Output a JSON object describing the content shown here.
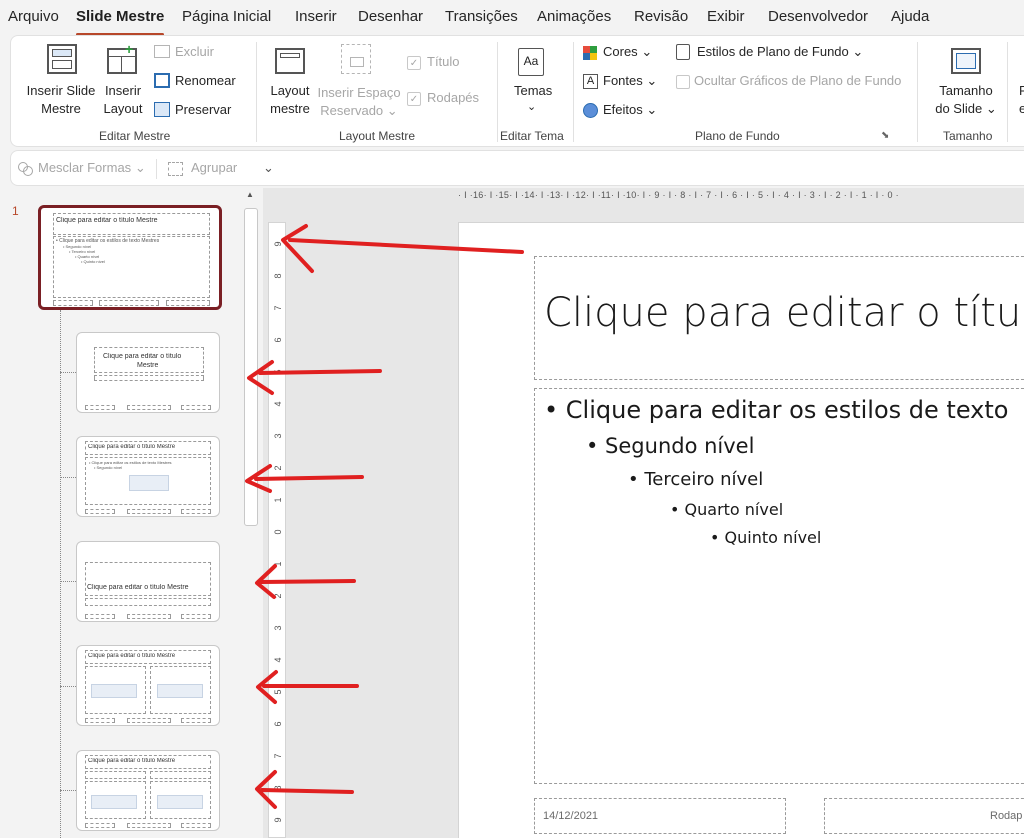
{
  "menu": {
    "tabs": [
      {
        "label": "Arquivo"
      },
      {
        "label": "Slide Mestre"
      },
      {
        "label": "Página Inicial"
      },
      {
        "label": "Inserir"
      },
      {
        "label": "Desenhar"
      },
      {
        "label": "Transições"
      },
      {
        "label": "Animações"
      },
      {
        "label": "Revisão"
      },
      {
        "label": "Exibir"
      },
      {
        "label": "Desenvolvedor"
      },
      {
        "label": "Ajuda"
      }
    ]
  },
  "ribbon": {
    "editar_mestre": {
      "group_label": "Editar Mestre",
      "inserir_slide_mestre_1": "Inserir Slide",
      "inserir_slide_mestre_2": "Mestre",
      "inserir_layout_1": "Inserir",
      "inserir_layout_2": "Layout",
      "excluir": "Excluir",
      "renomear": "Renomear",
      "preservar": "Preservar"
    },
    "layout_mestre": {
      "group_label": "Layout Mestre",
      "layout_mestre_1": "Layout",
      "layout_mestre_2": "mestre",
      "inserir_espaco_1": "Inserir Espaço",
      "inserir_espaco_2": "Reservado",
      "titulo": "Título",
      "rodapes": "Rodapés"
    },
    "editar_tema": {
      "group_label": "Editar Tema",
      "temas": "Temas"
    },
    "plano_de_fundo": {
      "group_label": "Plano de Fundo",
      "cores": "Cores",
      "fontes": "Fontes",
      "efeitos": "Efeitos",
      "estilos": "Estilos de Plano de Fundo",
      "ocultar": "Ocultar Gráficos de Plano de Fundo"
    },
    "tamanho": {
      "group_label": "Tamanho",
      "tamanho_1": "Tamanho",
      "tamanho_2": "do Slide"
    }
  },
  "toolbar2": {
    "mesclar": "Mesclar Formas",
    "agrupar": "Agrupar"
  },
  "thumbnails": {
    "master_number": "1",
    "master_title": "Clique para editar o título Mestre",
    "master_body": "• Clique para editar os estilos de texto Mestres",
    "sub_levels": [
      "• Segundo nível",
      "• Terceiro nível",
      "• Quarto nível",
      "• Quinto nível"
    ],
    "layout_title_two_line_1": "Clique para editar o título",
    "layout_title_two_line_2": "Mestre",
    "layout_title": "Clique para editar o título Mestre"
  },
  "ruler": {
    "horizontal": "· I ·16· I ·15· I ·14· I ·13· I ·12· I ·11· I ·10· I · 9 · I · 8 · I · 7 · I · 6 · I · 5 · I · 4 · I · 3 · I · 2 · I · 1 · I · 0 ·",
    "vertical_numbers": [
      "9",
      "8",
      "7",
      "6",
      "5",
      "4",
      "3",
      "2",
      "1",
      "0",
      "1",
      "2",
      "3",
      "4",
      "5",
      "6",
      "7",
      "8",
      "9"
    ]
  },
  "slide": {
    "title": "Clique para editar o títu",
    "level1": "• Clique para editar os estilos de texto",
    "level2": "• Segundo nível",
    "level3": "• Terceiro nível",
    "level4": "• Quarto nível",
    "level5": "• Quinto nível",
    "date": "14/12/2021",
    "footer": "Rodap"
  },
  "colors": {
    "accent": "#b7472a",
    "selected_thumb_border": "#7a1f24",
    "annotation_arrow": "#e02020"
  }
}
